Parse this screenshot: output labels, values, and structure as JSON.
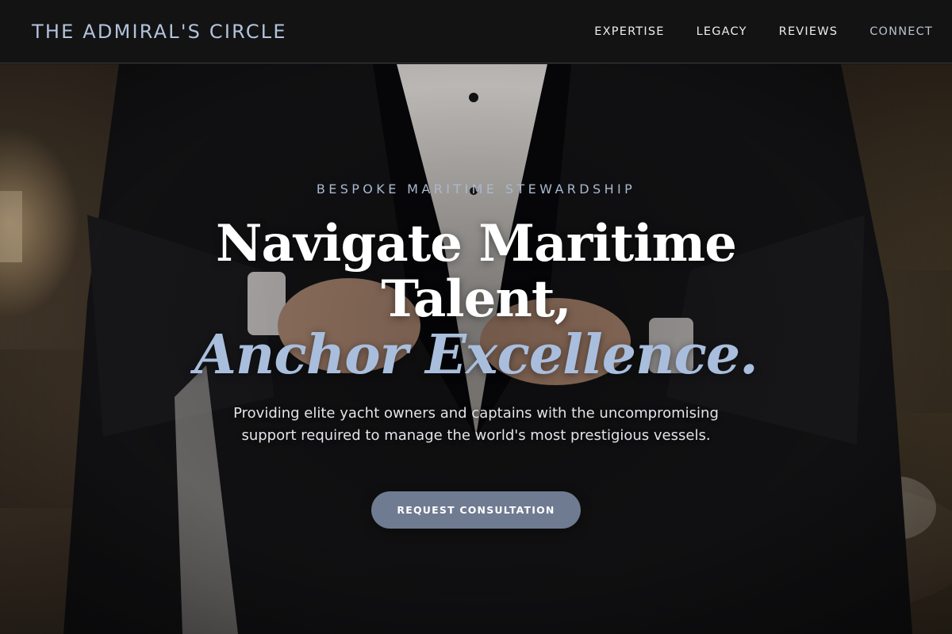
{
  "header": {
    "brand": "THE ADMIRAL'S CIRCLE",
    "nav": [
      {
        "label": "EXPERTISE"
      },
      {
        "label": "LEGACY"
      },
      {
        "label": "REVIEWS"
      },
      {
        "label": "CONNECT"
      }
    ]
  },
  "hero": {
    "eyebrow": "BESPOKE MARITIME STEWARDSHIP",
    "headline_line1": "Navigate Maritime",
    "headline_line2": "Talent,",
    "headline_accent": "Anchor Excellence.",
    "subcopy": "Providing elite yacht owners and captains with the uncompromising support required to manage the world's most prestigious vessels.",
    "cta_label": "REQUEST CONSULTATION",
    "background_image": "man-in-tuxedo-buttoning-jacket"
  },
  "colors": {
    "brand": "#b3c3dd",
    "accent_text": "#a9bedd",
    "cta_background": "#6f7b91",
    "nav_background": "#131313"
  }
}
